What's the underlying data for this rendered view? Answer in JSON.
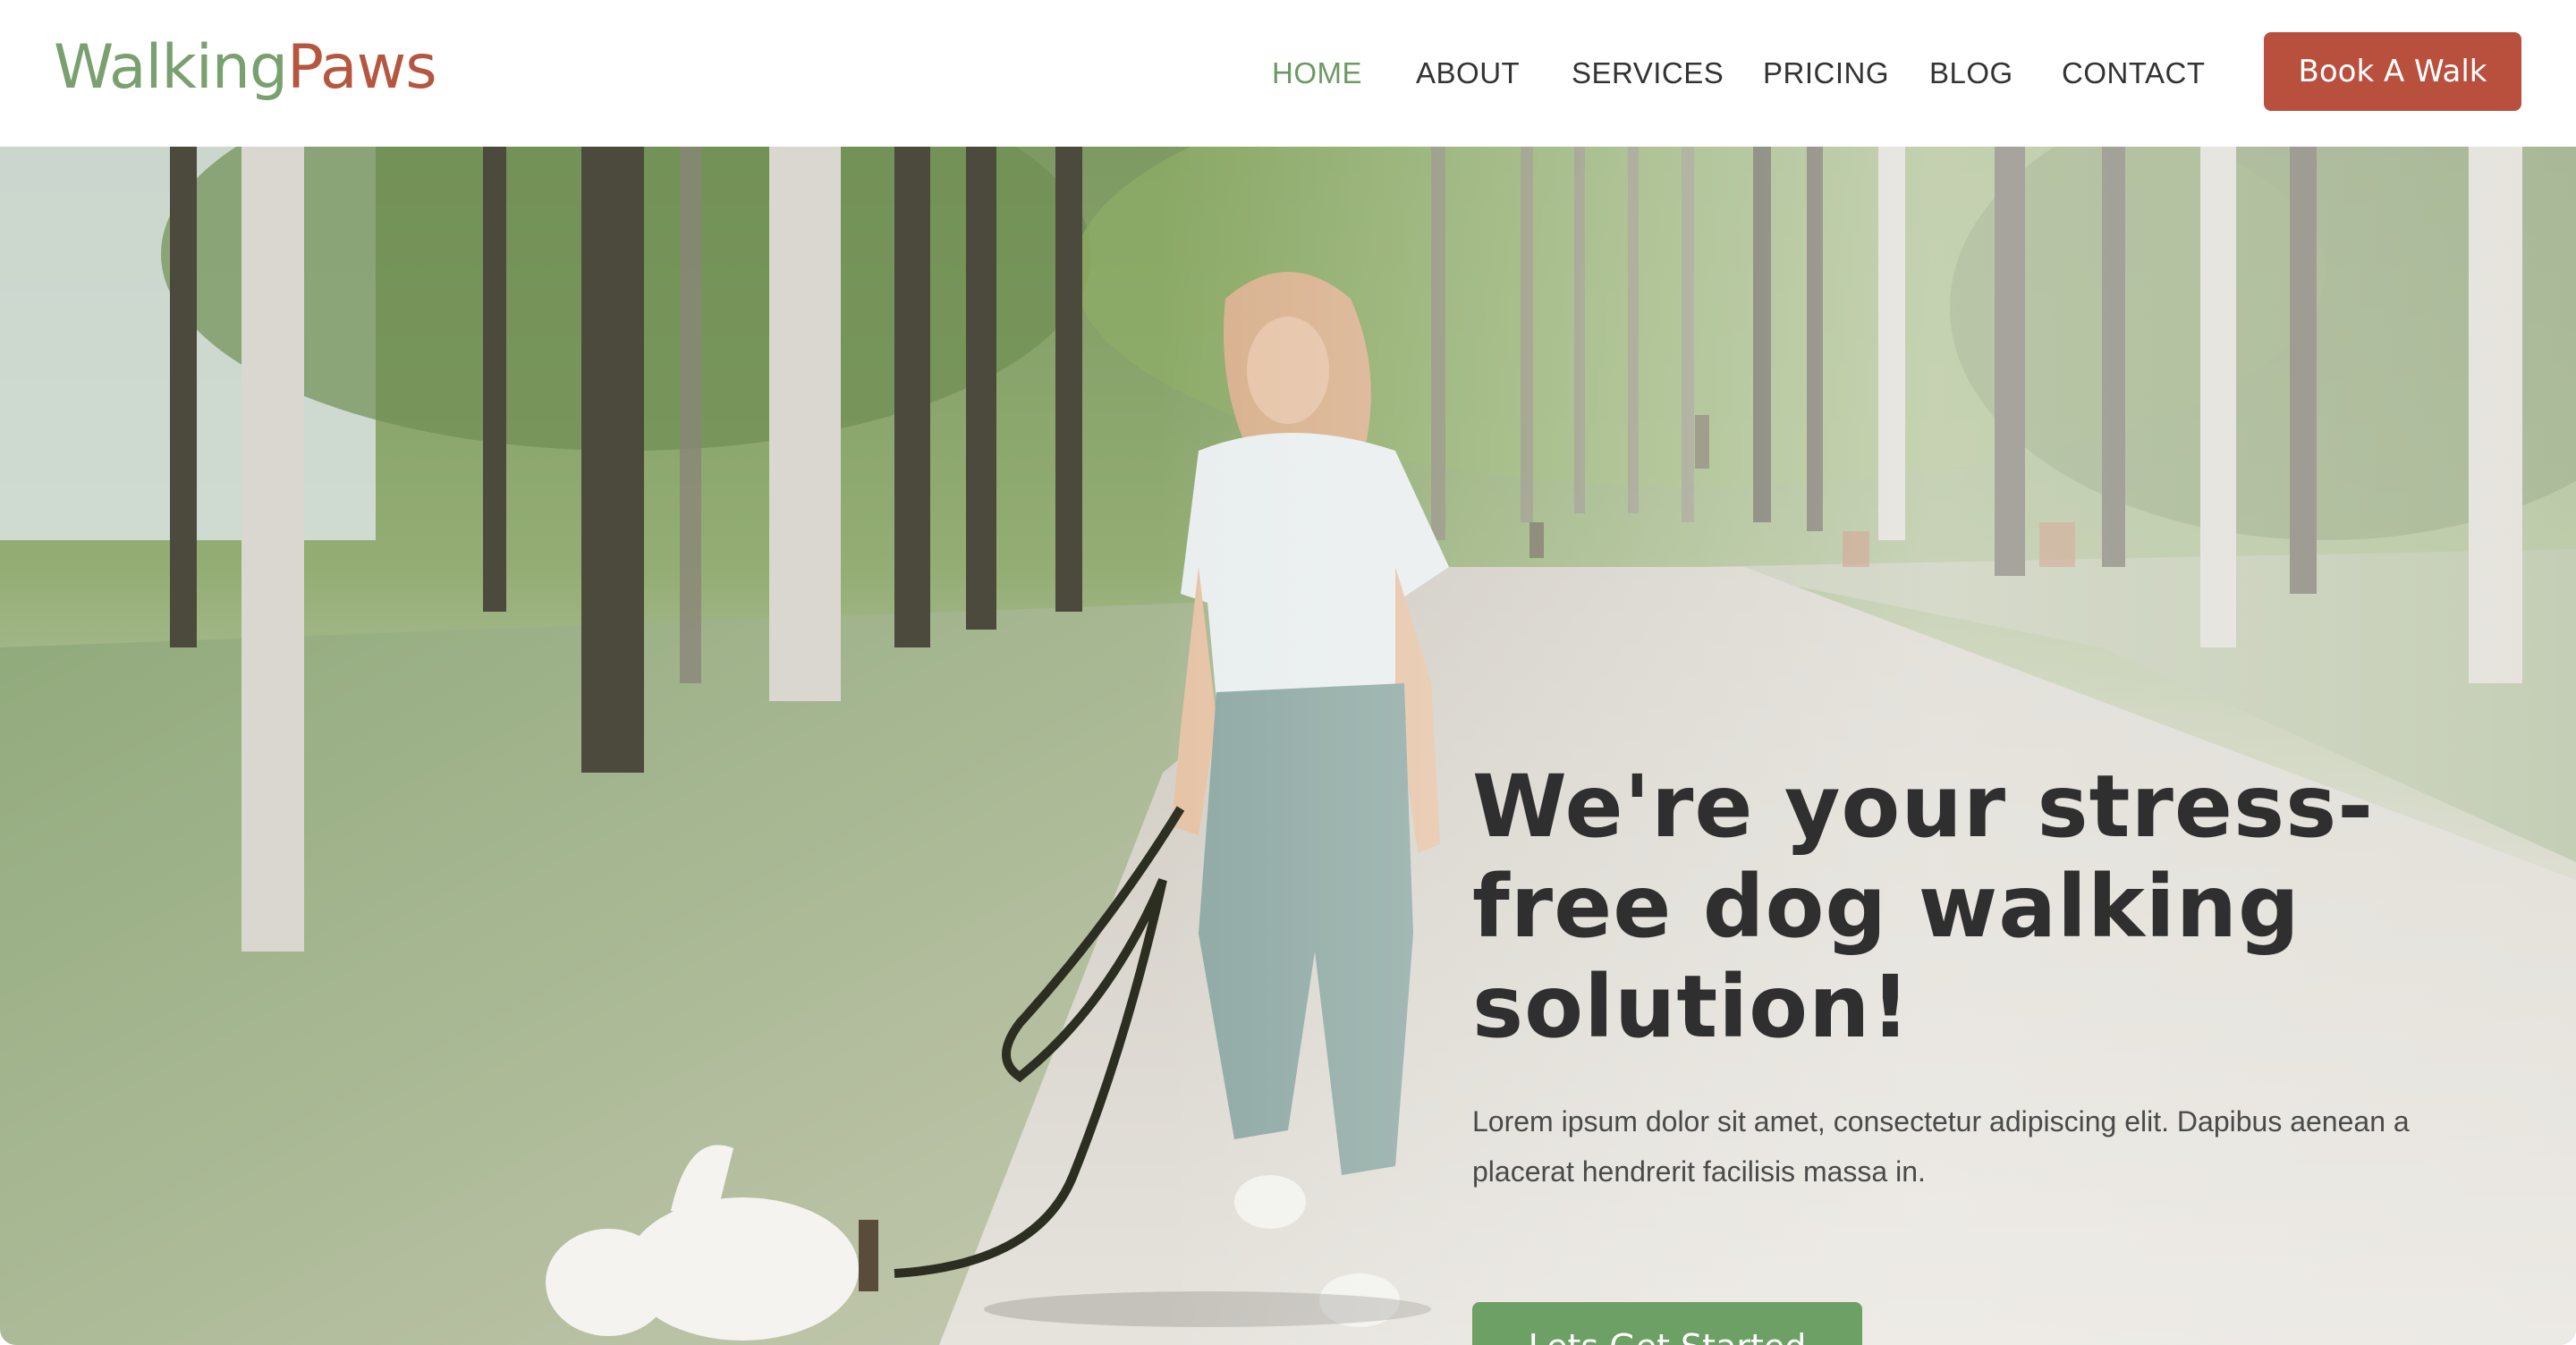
{
  "brand": {
    "part1": "Walking",
    "part2": "Paws"
  },
  "nav": {
    "items": [
      {
        "label": "HOME",
        "active": true
      },
      {
        "label": "ABOUT",
        "active": false
      },
      {
        "label": "SERVICES",
        "active": false
      },
      {
        "label": "PRICING",
        "active": false
      },
      {
        "label": "BLOG",
        "active": false
      },
      {
        "label": "CONTACT",
        "active": false
      }
    ],
    "cta_label": "Book A Walk"
  },
  "hero": {
    "headline": "We're your stress-free dog walking solution!",
    "subtext": "Lorem ipsum dolor sit amet, consectetur adipiscing elit. Dapibus aenean a placerat hendrerit facilisis massa in.",
    "cta_label": "Lets Get Started",
    "image_subject": "woman walking a small white dog on a leash along a tree-lined park path"
  },
  "colors": {
    "brand_green": "#6ca064",
    "brand_red": "#b9503e",
    "text_dark": "#2f2f2f"
  }
}
